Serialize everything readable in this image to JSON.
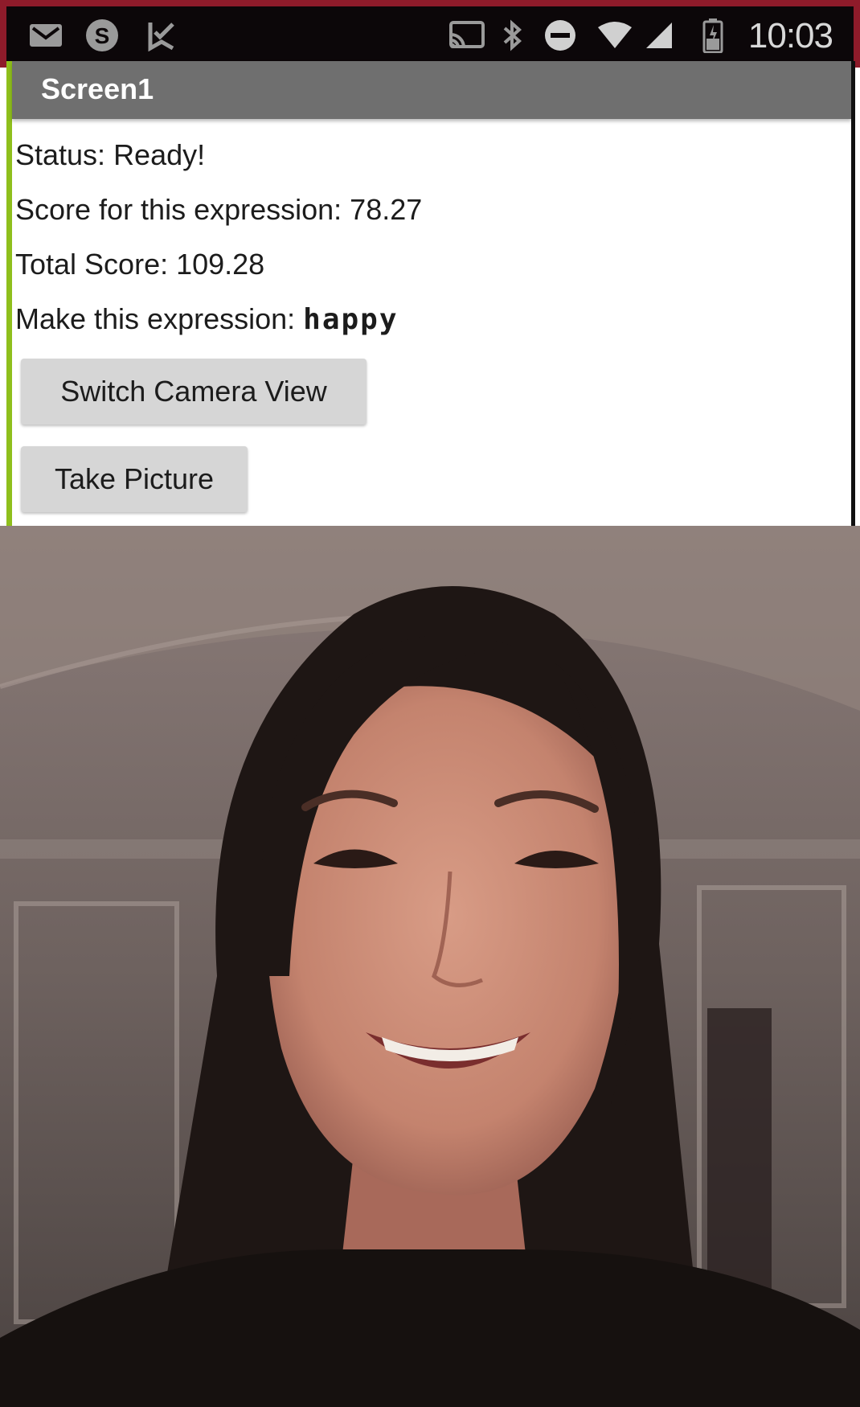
{
  "status_bar": {
    "time": "10:03",
    "left_icons": [
      "gmail-icon",
      "skype-icon",
      "download-check-icon"
    ],
    "right_icons": [
      "cast-icon",
      "bluetooth-icon",
      "do-not-disturb-icon",
      "wifi-icon",
      "cell-signal-icon",
      "battery-charging-icon"
    ]
  },
  "app": {
    "title": "Screen1",
    "status_label": "Status: Ready!",
    "score_label": "Score for this expression: 78.27",
    "total_label": "Total Score: 109.28",
    "expression_prompt": "Make this expression:",
    "expression_value": "happy",
    "switch_camera_label": "Switch Camera View",
    "take_picture_label": "Take Picture"
  },
  "colors": {
    "title_bar": "#6f6f6f",
    "status_bar": "#0c0709",
    "status_bar_border": "#8e1b2a",
    "accent_edge": "#8fbf1c",
    "button_bg": "#d6d6d6"
  }
}
